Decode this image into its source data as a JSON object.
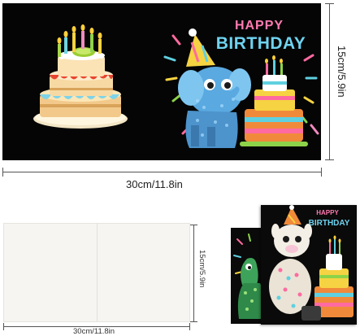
{
  "large_card": {
    "greeting_line1": "HAPPY",
    "greeting_line2": "BIRTHDAY"
  },
  "dimensions_large": {
    "width_label": "30cm/11.8in",
    "height_label": "15cm/5.9in"
  },
  "dimensions_small": {
    "width_label": "30cm/11.8in",
    "height_label": "15cm/5.9in"
  },
  "small_card": {
    "greeting_line1": "HAPPY",
    "greeting_line2": "BIRTHDAY"
  },
  "colors": {
    "card_background": "#050505",
    "blank_card": "#f6f5f2",
    "dimension_line": "#555555"
  }
}
